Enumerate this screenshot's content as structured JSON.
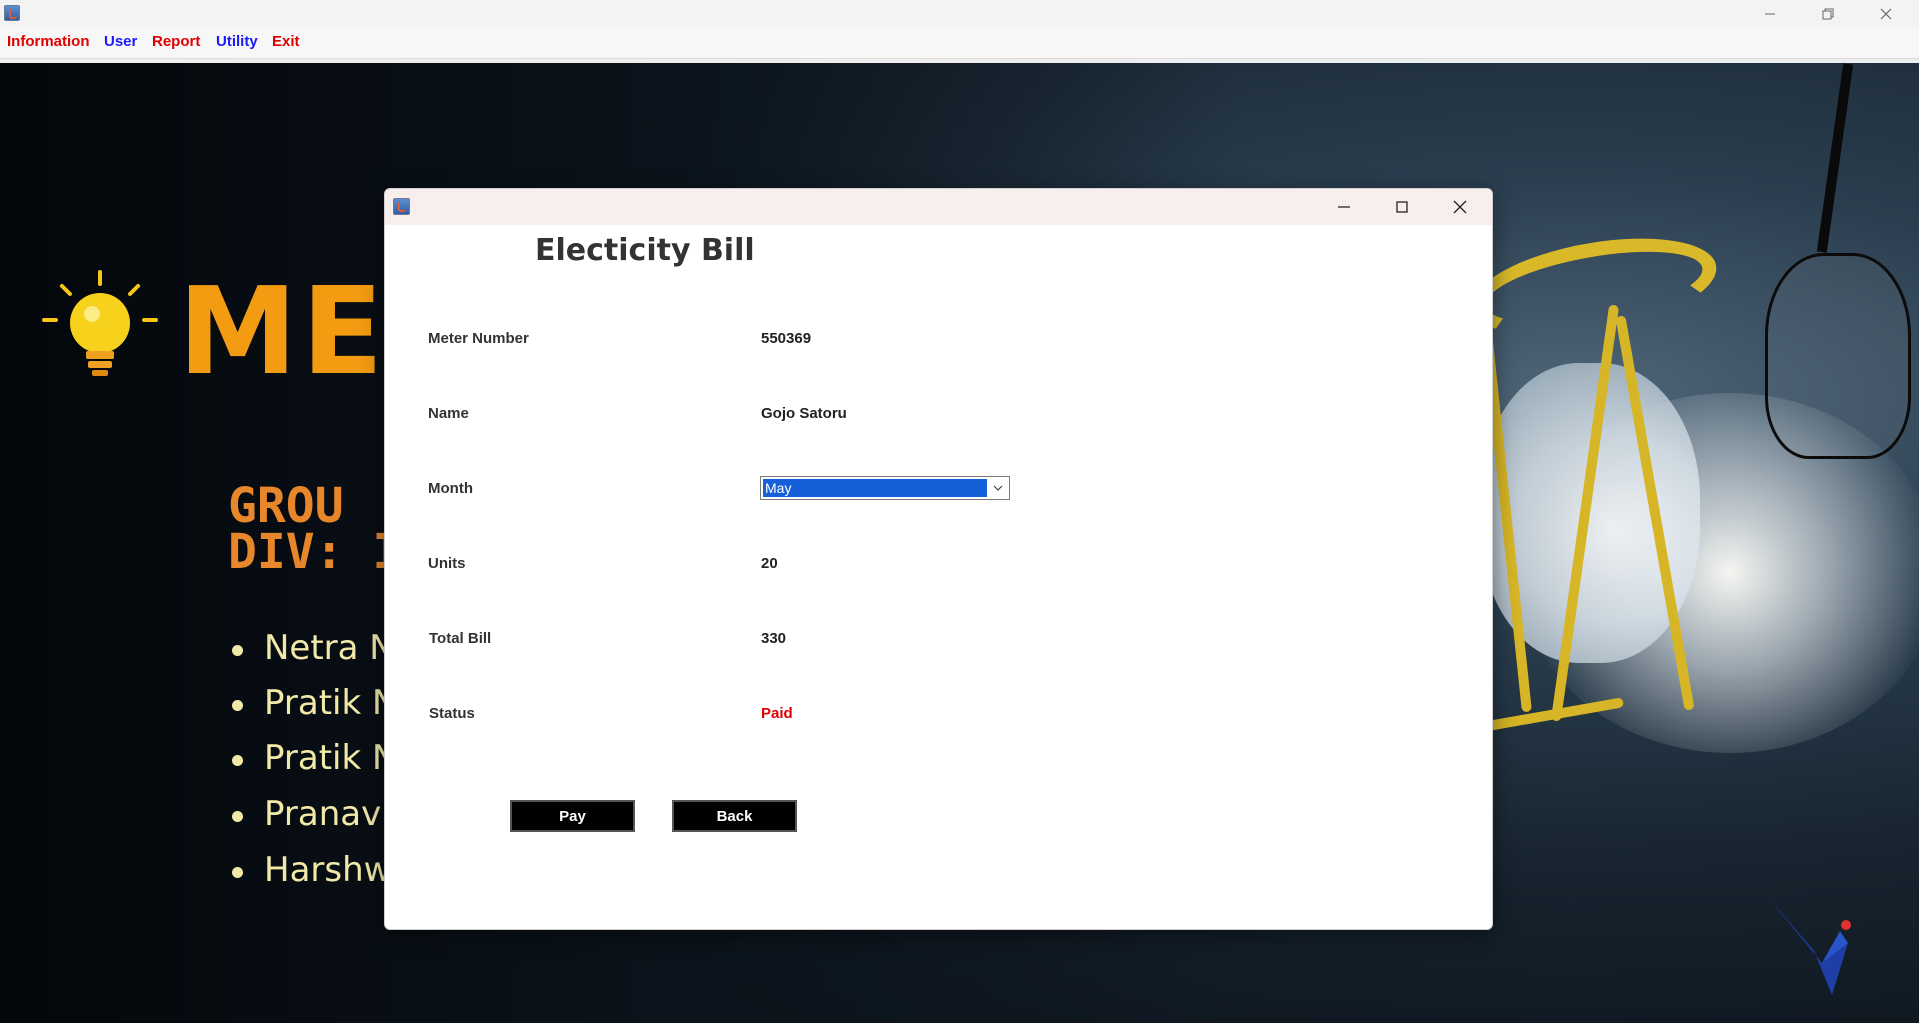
{
  "window": {
    "icon": "java-cup-icon",
    "controls": [
      "minimize-icon",
      "restore-icon",
      "close-icon"
    ]
  },
  "menu": {
    "items": [
      {
        "label": "Information",
        "color": "#e00000"
      },
      {
        "label": "User",
        "color": "#1a1aff"
      },
      {
        "label": "Report",
        "color": "#e00000"
      },
      {
        "label": "Utility",
        "color": "#1a1aff"
      },
      {
        "label": "Exit",
        "color": "#e00000"
      }
    ]
  },
  "background": {
    "heading": "MET",
    "group_lines": [
      "GROU",
      "DIV: I"
    ],
    "members": [
      "Netra N",
      "Pratik N",
      "Pratik N",
      "Pranav",
      "Harshw"
    ],
    "colors": {
      "heading": "#f39c12",
      "group": "#e8862b",
      "members": "#f1e9a8"
    }
  },
  "dialog": {
    "title": "Electicity Bill",
    "fields": [
      {
        "label": "Meter Number",
        "value": "550369"
      },
      {
        "label": "Name",
        "value": "Gojo Satoru"
      },
      {
        "label": "Month",
        "value": "May"
      },
      {
        "label": "Units",
        "value": "20"
      },
      {
        "label": "Total Bill",
        "value": "330"
      },
      {
        "label": "Status",
        "value": "Paid"
      }
    ],
    "status_color": "#e00000",
    "buttons": {
      "pay": "Pay",
      "back": "Back"
    }
  }
}
